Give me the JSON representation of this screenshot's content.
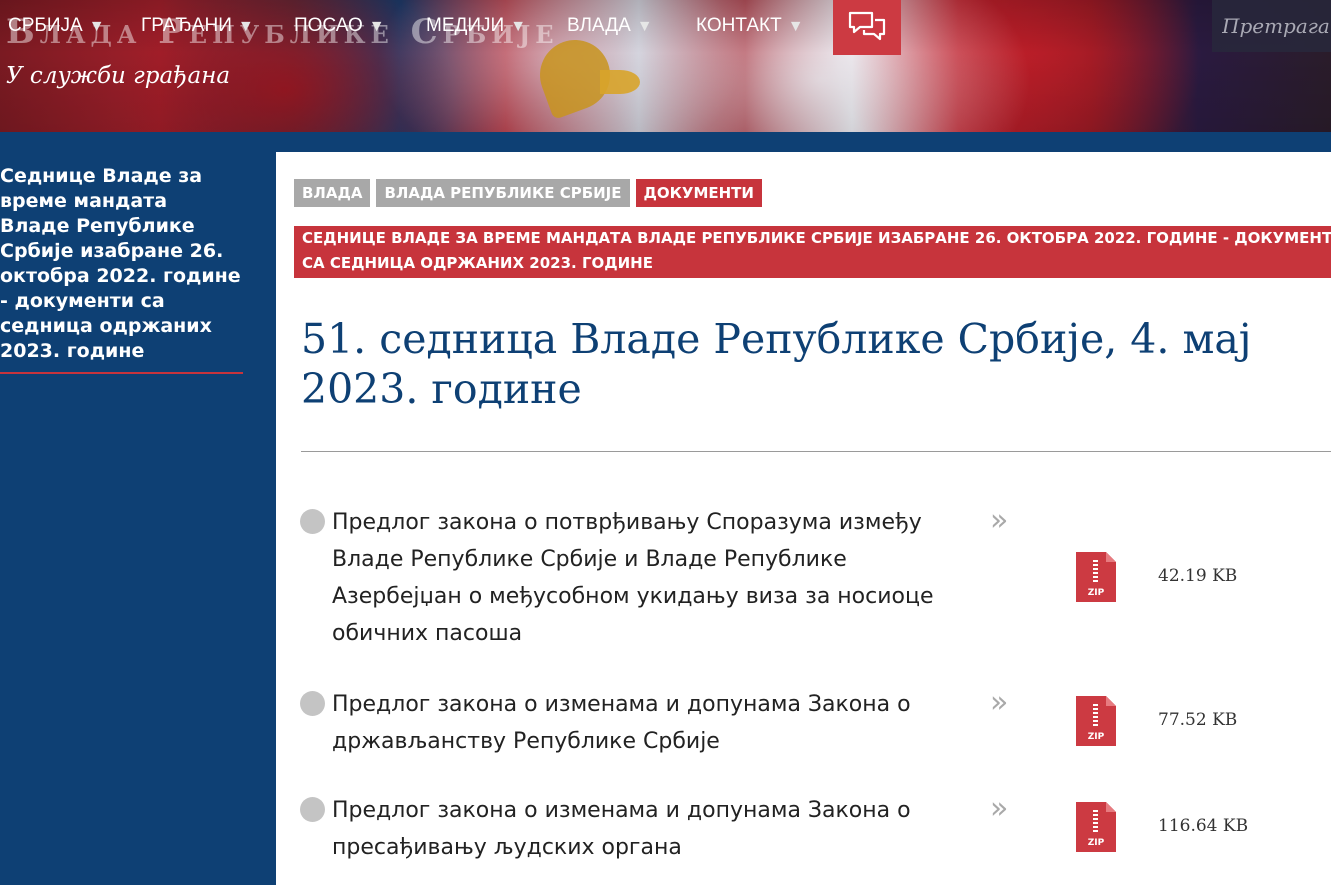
{
  "header": {
    "site_title": "Влада Републике Србије",
    "subtitle": "У служби грађана",
    "nav": [
      "СРБИЈА",
      "ГРАЂАНИ",
      "ПОСАО",
      "МЕДИЈИ",
      "ВЛАДА",
      "КОНТАКТ"
    ],
    "search_placeholder": "Претрага..."
  },
  "sidebar": {
    "link": "Седнице Владе за време мандата Владе Републике Србије изабране 26. октобра 2022. године - документи са седница одржаних 2023. године"
  },
  "breadcrumbs": [
    "ВЛАДА",
    "ВЛАДА РЕПУБЛИКЕ СРБИЈЕ",
    "ДОКУМЕНТИ"
  ],
  "section_banner": "СЕДНИЦЕ ВЛАДЕ ЗА ВРЕМЕ МАНДАТА ВЛАДЕ РЕПУБЛИКЕ СРБИЈЕ ИЗАБРАНЕ 26. ОКТОБРА 2022. ГОДИНЕ - ДОКУМЕНТИ СА СЕДНИЦА ОДРЖАНИХ 2023. ГОДИНЕ",
  "page_title": "51. седница Владе Републике Србије, 4. мај 2023. године",
  "documents": [
    {
      "title": "Предлог закона о потврђивању Споразума између Владе Републике Србије и Владе Републике Азербејџан о међусобном укидању виза за носиоце обичних пасоша",
      "size": "42.19 KB",
      "file_type": "ZIP"
    },
    {
      "title": "Предлог закона о изменама и допунама Закона о држављанству Републике Србије",
      "size": "77.52 KB",
      "file_type": "ZIP"
    },
    {
      "title": "Предлог закона о изменама и допунама Закона о пресађивању људских органа",
      "size": "116.64 KB",
      "file_type": "ZIP"
    }
  ],
  "icons": {
    "chat": "chat-bubbles-icon",
    "more": "double-chevron-right-icon",
    "file": "zip-file-icon",
    "bullet": "bullet-circle-icon"
  },
  "colors": {
    "primary_blue": "#0e4074",
    "accent_red": "#c7343c",
    "crumb_gray": "#a8a8a8"
  }
}
